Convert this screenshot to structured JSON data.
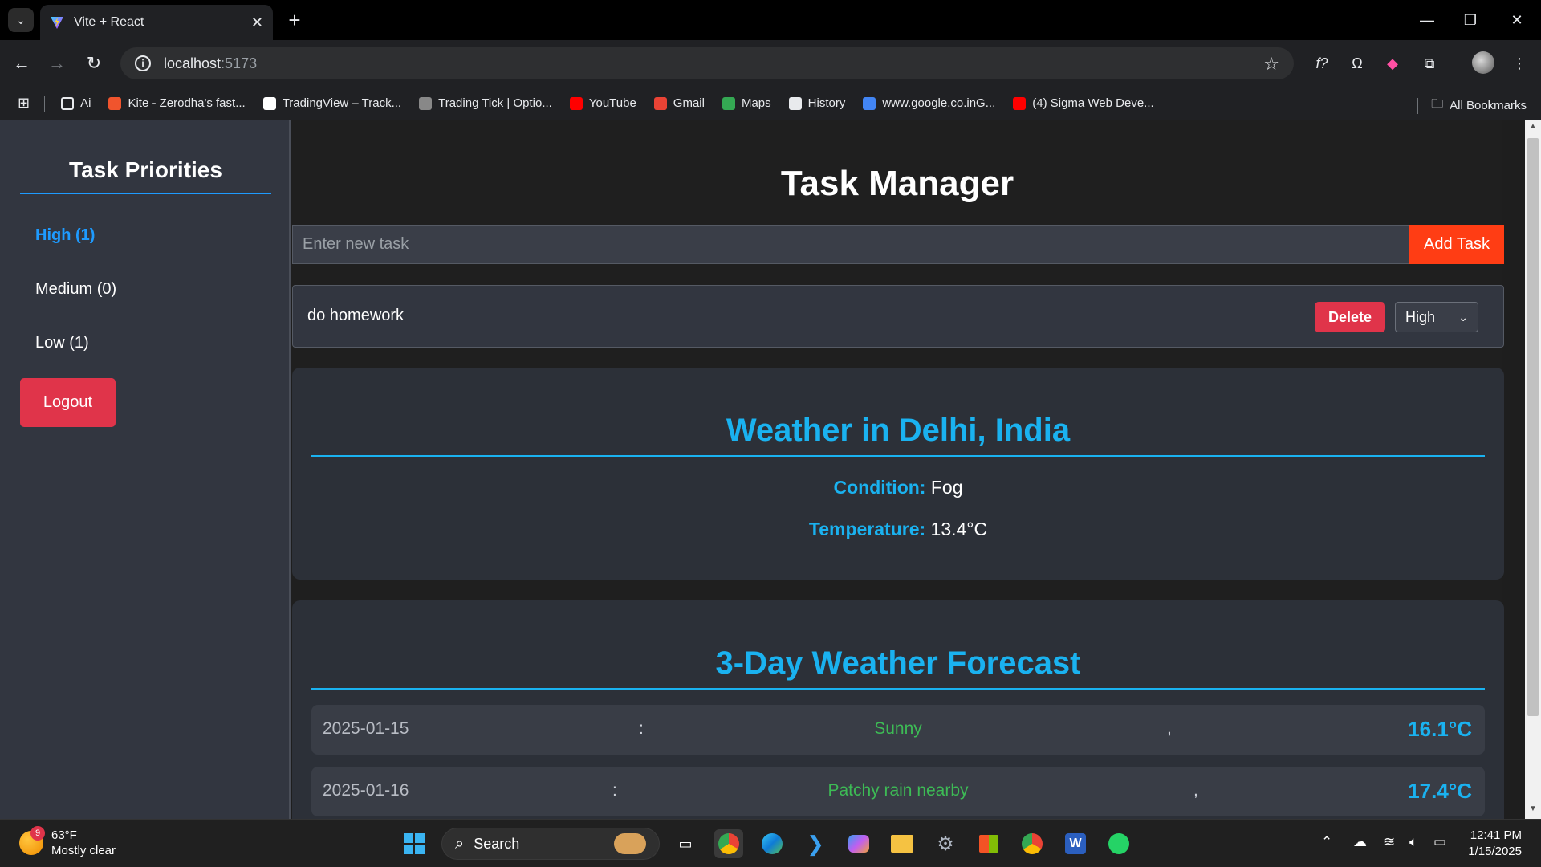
{
  "browser": {
    "tab_title": "Vite + React",
    "url_host": "localhost",
    "url_port": ":5173",
    "bookmarks": [
      {
        "label": "Ai",
        "color": "#e8eaed"
      },
      {
        "label": "Kite - Zerodha's fast...",
        "color": "#f0542d"
      },
      {
        "label": "TradingView – Track...",
        "color": "#ffffff"
      },
      {
        "label": "Trading Tick | Optio...",
        "color": "#888888"
      },
      {
        "label": "YouTube",
        "color": "#ff0000"
      },
      {
        "label": "Gmail",
        "color": "#ea4335"
      },
      {
        "label": "Maps",
        "color": "#34a853"
      },
      {
        "label": "History",
        "color": "#e8eaed"
      },
      {
        "label": "www.google.co.inG...",
        "color": "#4285f4"
      },
      {
        "label": "(4) Sigma Web Deve...",
        "color": "#ff0000"
      }
    ],
    "all_bookmarks": "All Bookmarks"
  },
  "sidebar": {
    "title": "Task Priorities",
    "items": [
      {
        "label": "High (1)",
        "active": true
      },
      {
        "label": "Medium (0)",
        "active": false
      },
      {
        "label": "Low (1)",
        "active": false
      }
    ],
    "logout_label": "Logout"
  },
  "main": {
    "title": "Task Manager",
    "input_placeholder": "Enter new task",
    "input_value": "",
    "add_label": "Add Task",
    "tasks": [
      {
        "text": "do homework",
        "delete_label": "Delete",
        "priority": "High"
      }
    ]
  },
  "weather": {
    "title": "Weather in Delhi, India",
    "condition_label": "Condition:",
    "condition_value": "Fog",
    "temperature_label": "Temperature:",
    "temperature_value": "13.4°C"
  },
  "forecast": {
    "title": "3-Day Weather Forecast",
    "rows": [
      {
        "date": "2025-01-15",
        "sep1": ":",
        "condition": "Sunny",
        "sep2": ",",
        "temp": "16.1°C"
      },
      {
        "date": "2025-01-16",
        "sep1": ":",
        "condition": "Patchy rain nearby",
        "sep2": ",",
        "temp": "17.4°C"
      }
    ]
  },
  "taskbar": {
    "weather_badge": "9",
    "weather_temp": "63°F",
    "weather_desc": "Mostly clear",
    "search_label": "Search",
    "time": "12:41 PM",
    "date": "1/15/2025"
  }
}
